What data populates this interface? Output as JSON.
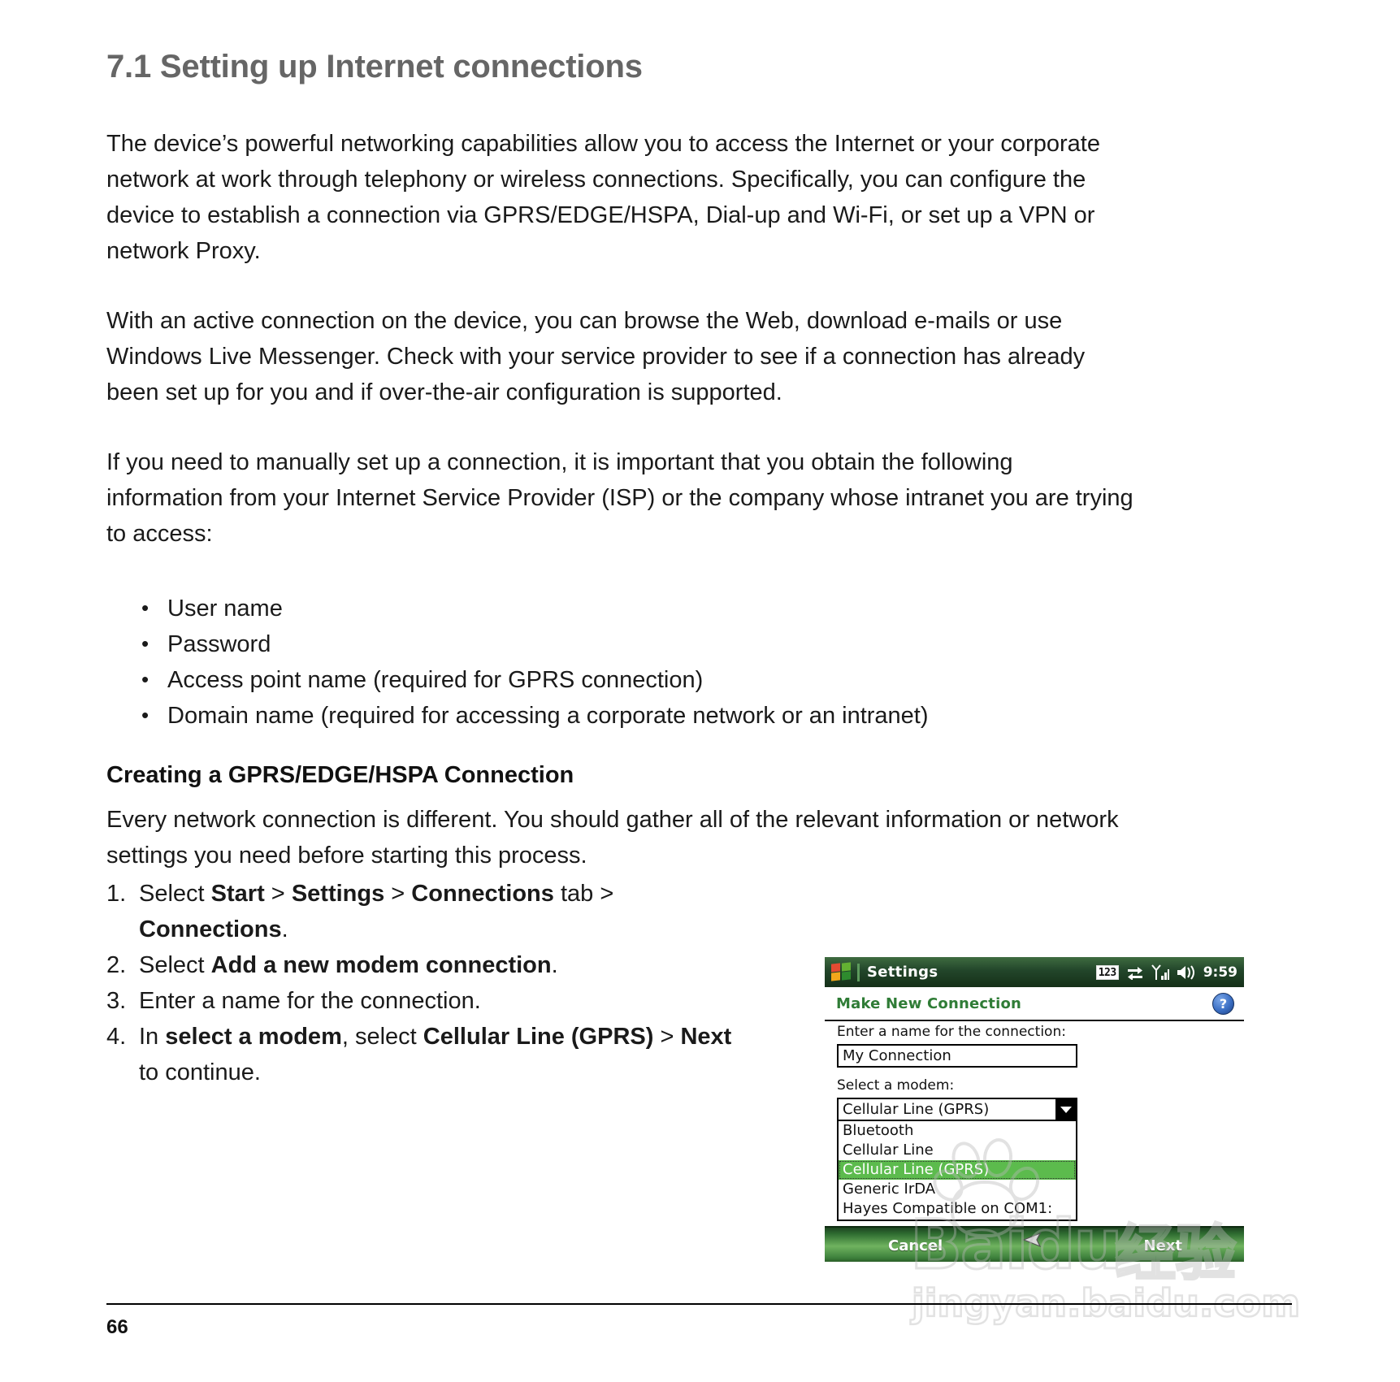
{
  "document": {
    "section_heading": "7.1 Setting up Internet connections",
    "paragraphs": [
      "The device’s powerful networking capabilities allow you to access the Internet or your corporate network at work through telephony or wireless connections. Specifically, you can configure the device to establish a connection via GPRS/EDGE/HSPA, Dial-up and Wi-Fi, or set up a VPN or network Proxy.",
      "With an active connection on the device, you can browse the Web, download e-mails or use Windows Live Messenger. Check with your service provider to see if a connection has already been set up for you and if over-the-air configuration is supported.",
      "If you need to manually set up a connection, it is important that you obtain the following information from your Internet Service Provider (ISP) or the company whose intranet you are trying to access:"
    ],
    "bullets": [
      "User name",
      "Password",
      "Access point name (required for GPRS connection)",
      "Domain name (required for accessing a corporate network or an intranet)"
    ],
    "sub_heading": "Creating a GPRS/EDGE/HSPA Connection",
    "intro_text": "Every network connection is different. You should gather all of the relevant information or network settings you need before starting this process.",
    "steps": [
      {
        "num": "1.",
        "parts": [
          {
            "t": "Select ",
            "b": false
          },
          {
            "t": "Start",
            "b": true
          },
          {
            "t": " > ",
            "b": false
          },
          {
            "t": "Settings",
            "b": true
          },
          {
            "t": " > ",
            "b": false
          },
          {
            "t": "Connections",
            "b": true
          },
          {
            "t": " tab > ",
            "b": false
          },
          {
            "t": "Connections",
            "b": true
          },
          {
            "t": ".",
            "b": false
          }
        ]
      },
      {
        "num": "2.",
        "parts": [
          {
            "t": "Select ",
            "b": false
          },
          {
            "t": "Add a new modem connection",
            "b": true
          },
          {
            "t": ".",
            "b": false
          }
        ]
      },
      {
        "num": "3.",
        "parts": [
          {
            "t": "Enter a name for the connection.",
            "b": false
          }
        ]
      },
      {
        "num": "4.",
        "parts": [
          {
            "t": "In ",
            "b": false
          },
          {
            "t": "select a modem",
            "b": true
          },
          {
            "t": ", select ",
            "b": false
          },
          {
            "t": "Cellular Line (GPRS)",
            "b": true
          },
          {
            "t": " > ",
            "b": false
          },
          {
            "t": "Next",
            "b": true
          },
          {
            "t": " to continue.",
            "b": false
          }
        ]
      }
    ],
    "page_number": "66"
  },
  "pda": {
    "titlebar": {
      "app_title": "Settings",
      "logo_icon": "windows-logo-icon",
      "tray": {
        "input_mode": "123",
        "connectivity_icon": "connectivity-arrows-icon",
        "signal_icon": "signal-bars-icon",
        "volume_icon": "speaker-icon",
        "time": "9:59"
      }
    },
    "header": {
      "title": "Make New Connection",
      "help_icon": "question-mark-help-icon",
      "help_label": "?"
    },
    "form": {
      "name_label": "Enter a name for the connection:",
      "name_value": "My Connection",
      "modem_label": "Select a modem:",
      "modem_selected": "Cellular Line (GPRS)",
      "dropdown_arrow_icon": "chevron-down-icon",
      "modem_options": [
        "Bluetooth",
        "Cellular Line",
        "Cellular Line (GPRS)",
        "Generic IrDA",
        "Hayes Compatible on COM1:"
      ],
      "highlighted_option_index": 2
    },
    "commandbar": {
      "cancel_label": "Cancel",
      "next_label": "Next",
      "cursor_icon": "stylus-cursor-icon"
    },
    "colors": {
      "titlebar_green": "#22452a",
      "header_green_text": "#2f7c36",
      "highlight_green": "#5cbb4d",
      "commandbar_green": "#6fb35f"
    }
  },
  "watermark": {
    "paw_icon": "baidu-paw-icon",
    "brand": "Baidu",
    "brand_cn": "经验",
    "url": "jingyan.baidu.com"
  }
}
